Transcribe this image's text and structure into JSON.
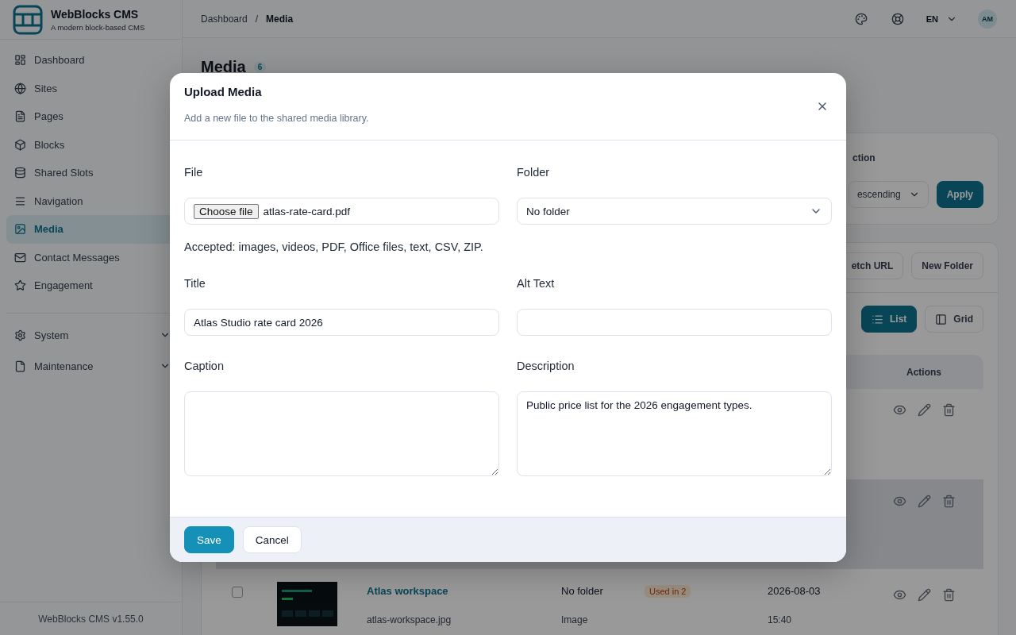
{
  "sidebar": {
    "brand": {
      "name": "WebBlocks CMS",
      "tagline": "A modern block-based CMS"
    },
    "items": [
      {
        "label": "Dashboard",
        "selected": false
      },
      {
        "label": "Sites",
        "selected": false
      },
      {
        "label": "Pages",
        "selected": false
      },
      {
        "label": "Blocks",
        "selected": false
      },
      {
        "label": "Shared Slots",
        "selected": false
      },
      {
        "label": "Navigation",
        "selected": false
      },
      {
        "label": "Media",
        "selected": true
      },
      {
        "label": "Contact Messages",
        "selected": false
      },
      {
        "label": "Engagement",
        "selected": false
      }
    ],
    "groups": [
      {
        "label": "System",
        "expanded": false
      },
      {
        "label": "Maintenance",
        "expanded": false
      }
    ],
    "footer": "WebBlocks CMS v1.55.0"
  },
  "topbar": {
    "breadcrumb": [
      "Dashboard",
      "Media"
    ],
    "separator": "/",
    "language": "EN",
    "avatar": "AM"
  },
  "page": {
    "title": "Media",
    "count": "6"
  },
  "filter": {
    "label": "ction",
    "select": "escending",
    "button": "Apply"
  },
  "toolbar": {
    "buttons": [
      "etch URL",
      "New Folder"
    ],
    "views": [
      {
        "label": "List",
        "selected": true
      },
      {
        "label": "Grid",
        "selected": false
      }
    ]
  },
  "table": {
    "actions_header": "Actions",
    "rows": [
      {
        "highlighted": false
      },
      {
        "highlighted": true
      },
      {
        "highlighted": false,
        "checked": false,
        "title": "Atlas workspace",
        "filename": "atlas-workspace.jpg",
        "folder": "No folder",
        "type": "Image",
        "usage": "Used in 2",
        "date": "2026-08-03",
        "time": "15:40"
      }
    ]
  },
  "modal": {
    "title": "Upload Media",
    "subtitle": "Add a new file to the shared media library.",
    "fields": [
      {
        "kind": "file",
        "label": "File",
        "button": "Choose file",
        "value": "atlas-rate-card.pdf",
        "help": "Accepted: images, videos, PDF, Office files, text, CSV, ZIP."
      },
      {
        "kind": "select",
        "label": "Folder",
        "value": "No folder"
      },
      {
        "kind": "text",
        "label": "Title",
        "value": "Atlas Studio rate card 2026"
      },
      {
        "kind": "text",
        "label": "Alt Text"
      },
      {
        "kind": "textarea",
        "label": "Caption"
      },
      {
        "kind": "textarea",
        "label": "Description",
        "value": "Public price list for the 2026 engagement types."
      }
    ],
    "buttons": [
      {
        "kind": "primary",
        "label": "Save"
      },
      {
        "kind": "secondary",
        "label": "Cancel"
      }
    ]
  }
}
